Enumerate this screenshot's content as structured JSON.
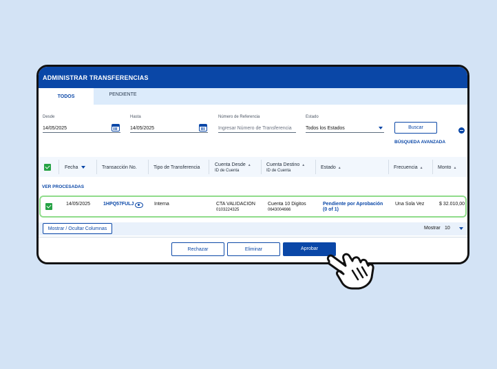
{
  "window": {
    "title": "ADMINISTRAR TRANSFERENCIAS"
  },
  "tabs": [
    {
      "label": "TODOS",
      "active": true
    },
    {
      "label": "PENDIENTE",
      "active": false
    }
  ],
  "filters": {
    "desde": {
      "label": "Desde",
      "value": "14/05/2025"
    },
    "hasta": {
      "label": "Hasta",
      "value": "14/05/2025"
    },
    "referencia": {
      "label": "Número de Referencia",
      "placeholder": "Ingresar Número de Transferencia"
    },
    "estado": {
      "label": "Estado",
      "value": "Todos los Estados"
    },
    "buscar_label": "Buscar",
    "advanced_label": "BÚSQUEDA AVANZADA"
  },
  "table": {
    "headers": {
      "fecha": "Fecha",
      "transaccion": "Transacción No.",
      "tipo": "Tipo de Transferencia",
      "cuenta_desde": "Cuenta Desde",
      "cuenta_desde_sub": "ID de Cuenta",
      "cuenta_destino": "Cuenta Destino",
      "cuenta_destino_sub": "ID de Cuenta",
      "estado": "Estado",
      "frecuencia": "Frecuencia",
      "monto": "Monto"
    },
    "section_label": "VER PROCESADAS",
    "rows": [
      {
        "fecha": "14/05/2025",
        "transaccion": "1HPQ57FULJ",
        "tipo": "Interna",
        "cuenta_desde": "CTA VALIDACION",
        "cuenta_desde_id": "0103224325",
        "cuenta_destino": "Cuenta 10 Digitos",
        "cuenta_destino_id": "0643004666",
        "estado": "Pendiente por Aprobación",
        "estado_count": "(0 of 1)",
        "frecuencia": "Una Sola Vez",
        "monto": "$ 32.010,00"
      }
    ]
  },
  "table_footer": {
    "columns_button": "Mostrar / Ocultar Columnas",
    "show_label": "Mostrar",
    "show_value": "10"
  },
  "actions": {
    "reject": "Rechazar",
    "delete": "Eliminar",
    "approve": "Aprobar"
  },
  "colors": {
    "brand": "#0a47a7",
    "selected_row_border": "#8fdc8a",
    "checkbox": "#25a244",
    "background": "#d3e3f5"
  }
}
